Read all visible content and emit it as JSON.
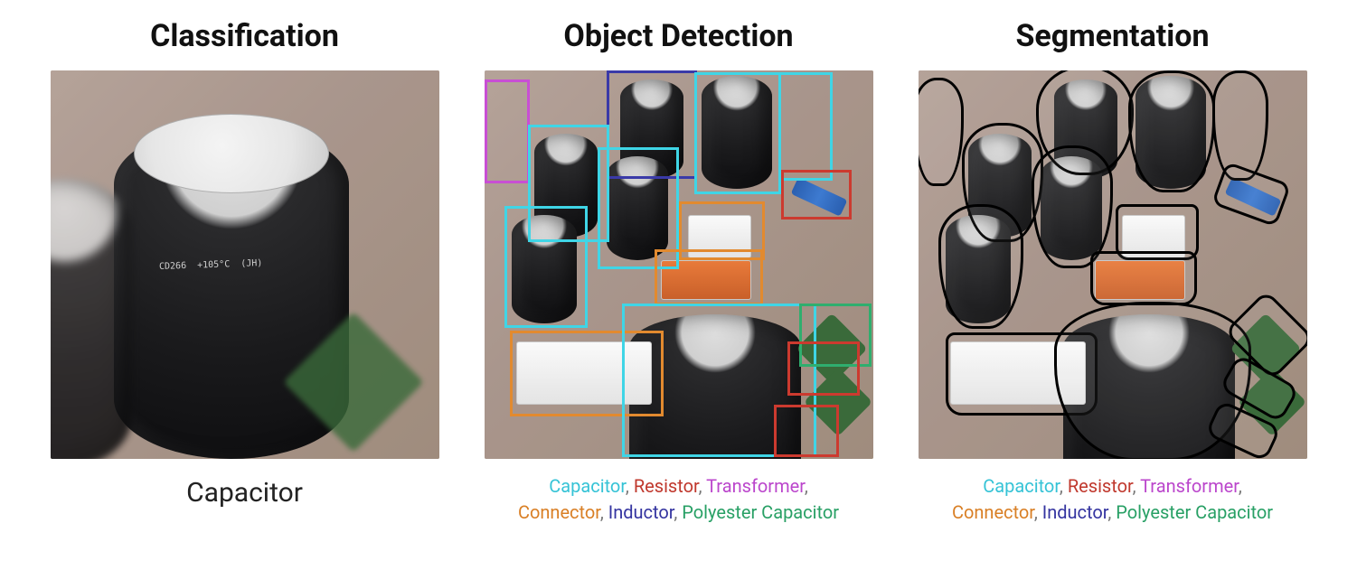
{
  "panels": {
    "classification": {
      "title": "Classification",
      "caption": "Capacitor",
      "visible_component_text": "CD266  +105°C  (JH)"
    },
    "detection": {
      "title": "Object Detection",
      "legend": [
        {
          "label": "Capacitor",
          "color": "cyan"
        },
        {
          "label": "Resistor",
          "color": "red"
        },
        {
          "label": "Transformer",
          "color": "magenta"
        },
        {
          "label": "Connector",
          "color": "orange"
        },
        {
          "label": "Inductor",
          "color": "navy"
        },
        {
          "label": "Polyester Capacitor",
          "color": "green"
        }
      ]
    },
    "segmentation": {
      "title": "Segmentation",
      "legend": [
        {
          "label": "Capacitor",
          "color": "cyan"
        },
        {
          "label": "Resistor",
          "color": "red"
        },
        {
          "label": "Transformer",
          "color": "magenta"
        },
        {
          "label": "Connector",
          "color": "orange"
        },
        {
          "label": "Inductor",
          "color": "navy"
        },
        {
          "label": "Polyester Capacitor",
          "color": "green"
        }
      ]
    }
  },
  "colors": {
    "cyan": "#35c3d6",
    "red": "#c0382d",
    "magenta": "#bb46cc",
    "orange": "#d97f25",
    "navy": "#3434a0",
    "green": "#28a065"
  }
}
